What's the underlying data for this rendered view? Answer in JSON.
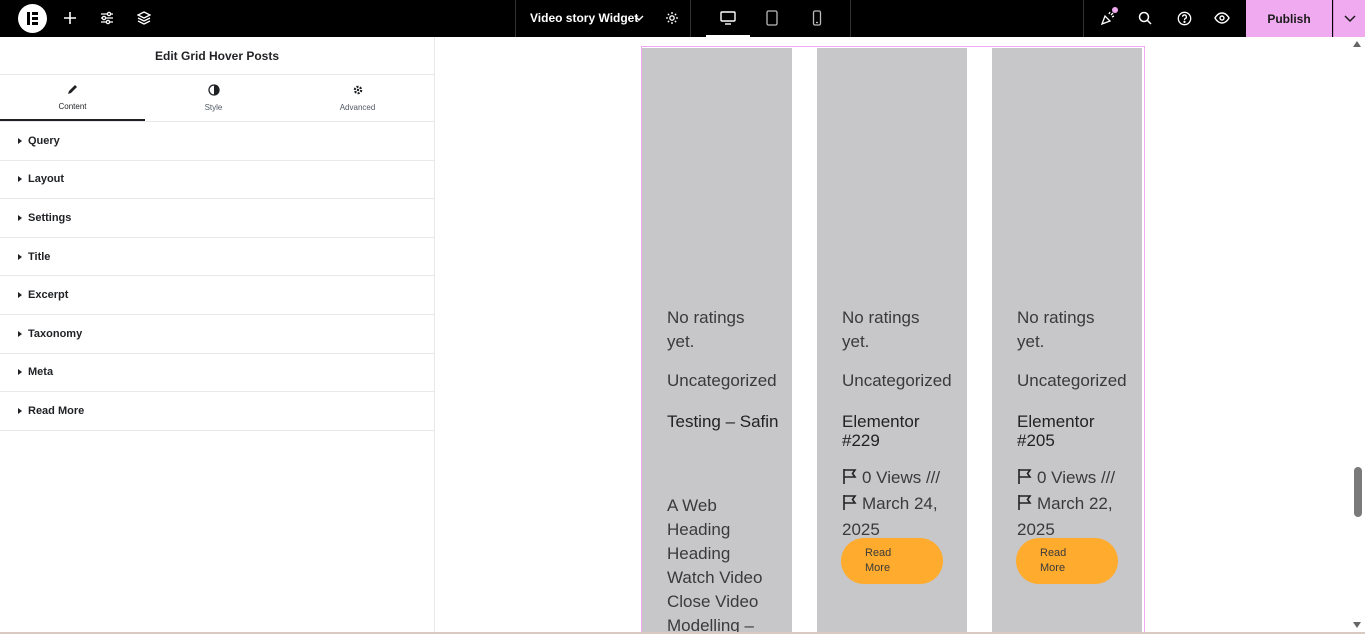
{
  "topbar": {
    "document_title": "Video story Widget",
    "publish_label": "Publish",
    "icons": [
      "elementor-logo-icon",
      "plus-icon",
      "sliders-icon",
      "layers-icon",
      "chevron-down-icon",
      "gear-icon",
      "desktop-icon",
      "tablet-icon",
      "mobile-icon",
      "whats-new-icon",
      "search-icon",
      "help-icon",
      "eye-icon"
    ],
    "accent_color": "#f0aaf0"
  },
  "panel": {
    "title": "Edit Grid Hover Posts",
    "tabs": [
      {
        "label": "Content",
        "icon": "pencil-icon",
        "active": true
      },
      {
        "label": "Style",
        "icon": "contrast-icon",
        "active": false
      },
      {
        "label": "Advanced",
        "icon": "gear-icon",
        "active": false
      }
    ],
    "sections": [
      {
        "label": "Query"
      },
      {
        "label": "Layout"
      },
      {
        "label": "Settings"
      },
      {
        "label": "Title"
      },
      {
        "label": "Excerpt"
      },
      {
        "label": "Taxonomy"
      },
      {
        "label": "Meta"
      },
      {
        "label": "Read More"
      }
    ]
  },
  "posts": [
    {
      "rating": "No ratings yet.",
      "category": "Uncategorized",
      "title": "Testing – Safin",
      "excerpt": "A Web Heading Heading Watch Video Close Video Modelling – Make"
    },
    {
      "rating": "No ratings yet.",
      "category": "Uncategorized",
      "title": "Elementor #229",
      "views": "0 Views ///",
      "date": "March 24, 2025",
      "read_more_line1": "Read",
      "read_more_line2": "More"
    },
    {
      "rating": "No ratings yet.",
      "category": "Uncategorized",
      "title": "Elementor #205",
      "views": "0 Views ///",
      "date": "March 22, 2025",
      "read_more_line1": "Read",
      "read_more_line2": "More"
    }
  ],
  "colors": {
    "card_bg": "#c7c7c9",
    "read_more_bg": "#ffab2e"
  }
}
